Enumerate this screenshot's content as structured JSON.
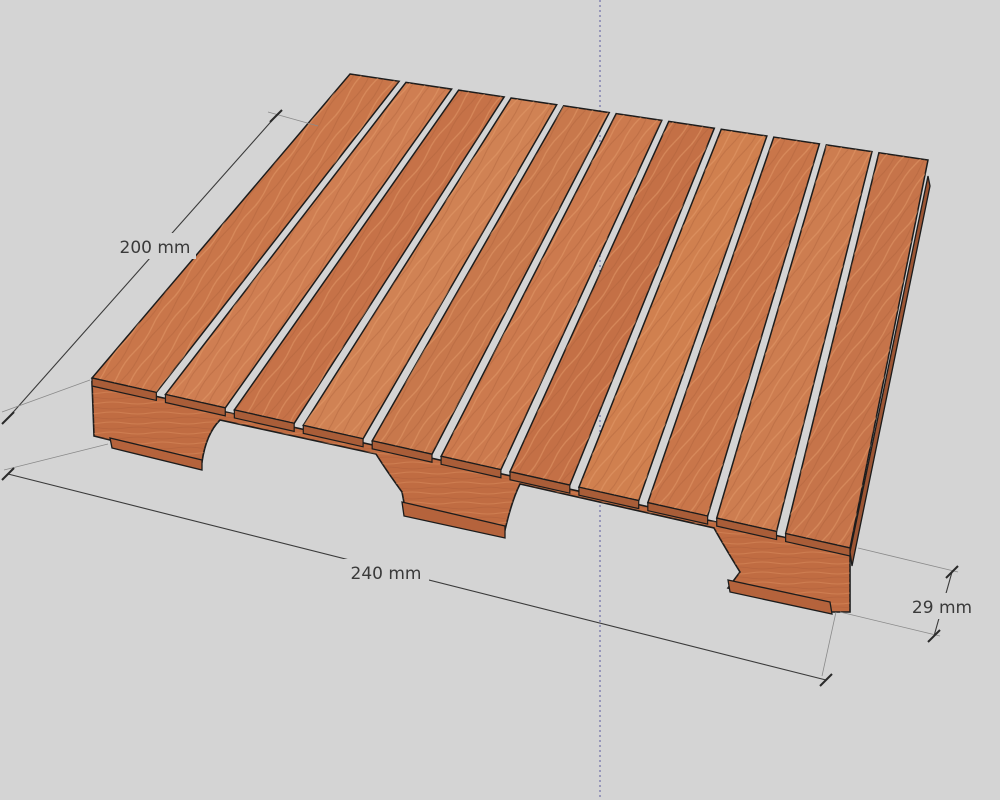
{
  "viewport": {
    "background": "#d4d4d4",
    "axis_color": "#5a5aa0"
  },
  "model": {
    "top_colors": [
      "#c9764a",
      "#cf7e52",
      "#c67248",
      "#d08254",
      "#c8784c",
      "#cc7a4e",
      "#c47046",
      "#d0804f",
      "#c9764a",
      "#cd7d50",
      "#c6744a"
    ],
    "front_color": "#c06c42",
    "edge_color": "#1c1c1c"
  },
  "dimensions": {
    "width": {
      "label": "200 mm"
    },
    "length": {
      "label": "240 mm"
    },
    "height": {
      "label": "29 mm"
    }
  }
}
